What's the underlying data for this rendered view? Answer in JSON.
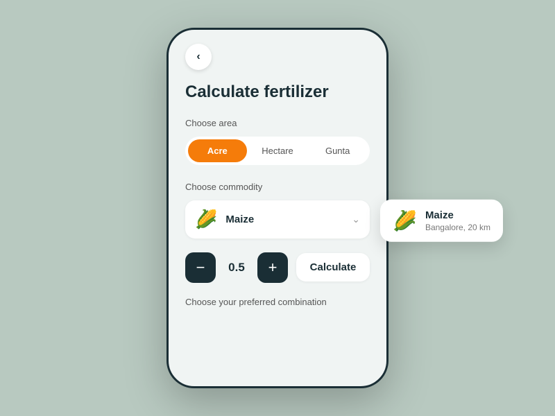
{
  "background_color": "#b8c9c0",
  "page": {
    "title": "Calculate fertilizer",
    "back_label": "‹"
  },
  "area_section": {
    "label": "Choose area",
    "tabs": [
      {
        "id": "acre",
        "label": "Acre",
        "active": true
      },
      {
        "id": "hectare",
        "label": "Hectare",
        "active": false
      },
      {
        "id": "gunta",
        "label": "Gunta",
        "active": false
      }
    ]
  },
  "commodity_section": {
    "label": "Choose commodity",
    "selected": {
      "icon": "🌽",
      "name": "Maize"
    }
  },
  "quantity": {
    "value": "0.5",
    "decrement_label": "−",
    "increment_label": "+"
  },
  "calculate_button": {
    "label": "Calculate"
  },
  "combination_label": "Choose your preferred combination",
  "tooltip": {
    "icon": "🌽",
    "name": "Maize",
    "location": "Bangalore, 20 km"
  }
}
